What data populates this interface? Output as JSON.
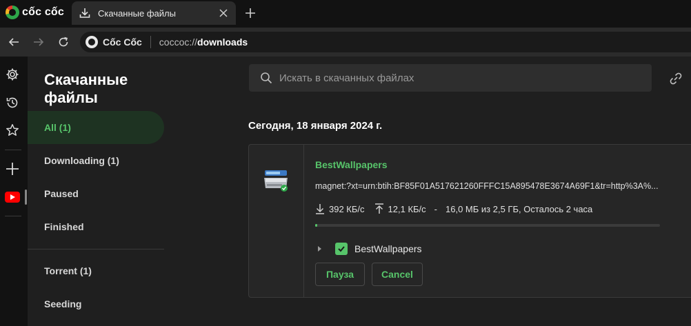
{
  "browser": {
    "brand": "cốc cốc",
    "tab_title": "Скачанные файлы",
    "omnibox_brand": "Cốc Cốc",
    "url_scheme": "coccoc://",
    "url_host": "downloads"
  },
  "downloads": {
    "page_title": "Скачанные файлы",
    "nav": [
      {
        "label": "All (1)",
        "active": true
      },
      {
        "label": "Downloading (1)",
        "active": false
      },
      {
        "label": "Paused",
        "active": false
      },
      {
        "label": "Finished",
        "active": false
      },
      {
        "label": "Torrent (1)",
        "active": false
      },
      {
        "label": "Seeding",
        "active": false
      }
    ],
    "search_placeholder": "Искать в скачанных файлах",
    "date_heading": "Сегодня, 18 января 2024 г.",
    "item": {
      "name": "BestWallpapers",
      "url": "magnet:?xt=urn:btih:BF85F01A517621260FFFC15A895478E3674A69F1&tr=http%3A%...",
      "download_speed": "392 КБ/с",
      "upload_speed": "12,1 КБ/с",
      "separator": "-",
      "progress_text": "16,0 МБ из 2,5 ГБ, Осталось 2 часа",
      "progress_fraction": 0.006,
      "subfile_name": "BestWallpapers",
      "pause_label": "Пауза",
      "cancel_label": "Cancel"
    }
  },
  "colors": {
    "accent": "#57c46a",
    "background": "#1f1f1f",
    "card": "#262626"
  }
}
